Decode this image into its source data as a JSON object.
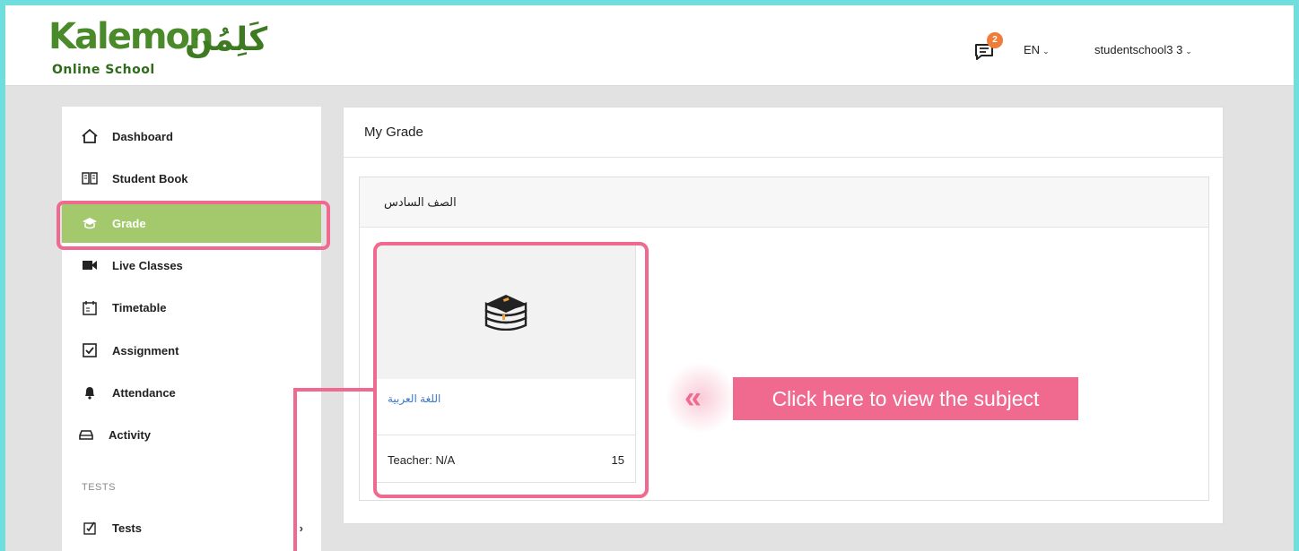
{
  "header": {
    "logo": {
      "brand": "Kalemon",
      "subtitle": "Online School",
      "arabic": "كَلِمُن"
    },
    "notifications_count": "2",
    "language": "EN",
    "user": "studentschool3 3"
  },
  "sidebar": {
    "items": [
      {
        "label": "Dashboard",
        "icon": "home-icon"
      },
      {
        "label": "Student Book",
        "icon": "book-icon"
      },
      {
        "label": "Grade",
        "icon": "graduation-cap-icon",
        "active": true
      },
      {
        "label": "Live Classes",
        "icon": "video-camera-icon"
      },
      {
        "label": "Timetable",
        "icon": "calendar-icon"
      },
      {
        "label": "Assignment",
        "icon": "checkbox-icon"
      },
      {
        "label": "Attendance",
        "icon": "bell-icon"
      },
      {
        "label": "Activity",
        "icon": "inbox-icon"
      }
    ],
    "section_tests": "TESTS",
    "tests_item": {
      "label": "Tests",
      "icon": "test-icon",
      "arrow": "›"
    }
  },
  "main": {
    "title": "My Grade",
    "grade_name": "الصف السادس",
    "subject": {
      "name": "اللغة العربية",
      "teacher": "Teacher: N/A",
      "count": "15",
      "icon": "books-stack-icon"
    }
  },
  "callout": {
    "text": "Click here to view the subject",
    "arrow": "«"
  },
  "colors": {
    "accent_green": "#a3c96c",
    "highlight_pink": "#f06a8f",
    "frame_cyan": "#6fdedd",
    "badge_orange": "#f07c3a",
    "link_blue": "#3a78c9"
  }
}
